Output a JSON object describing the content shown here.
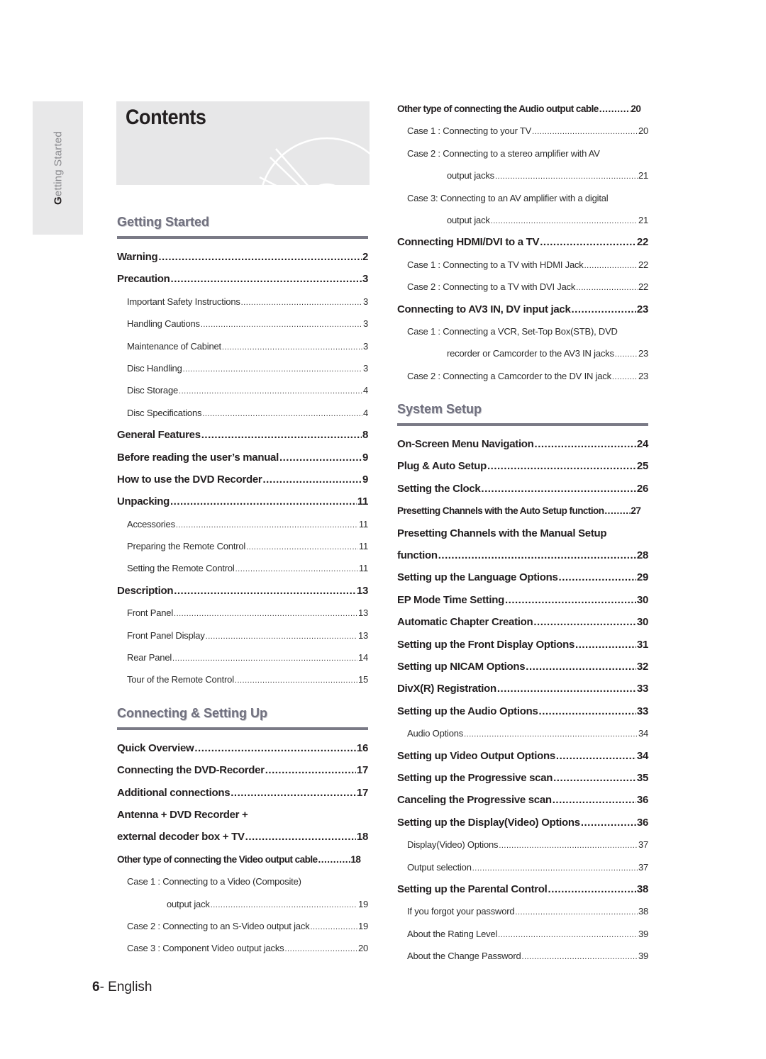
{
  "side_tab": {
    "first_letter": "G",
    "rest": "etting Started"
  },
  "title": "Contents",
  "left_column": {
    "sections": [
      {
        "heading": "Getting Started",
        "entries": [
          {
            "level": 1,
            "label": "Warning",
            "page": "2"
          },
          {
            "level": 1,
            "label": "Precaution",
            "page": "3"
          },
          {
            "level": 2,
            "label": "Important Safety Instructions",
            "page": "3"
          },
          {
            "level": 2,
            "label": "Handling Cautions",
            "page": "3"
          },
          {
            "level": 2,
            "label": "Maintenance of Cabinet",
            "page": "3"
          },
          {
            "level": 2,
            "label": "Disc Handling",
            "page": "3"
          },
          {
            "level": 2,
            "label": "Disc Storage",
            "page": "4"
          },
          {
            "level": 2,
            "label": "Disc Specifications",
            "page": "4"
          },
          {
            "level": 1,
            "label": "General Features",
            "page": "8"
          },
          {
            "level": 1,
            "label": "Before reading the user’s manual",
            "page": "9"
          },
          {
            "level": 1,
            "label": "How to use the DVD Recorder",
            "page": "9"
          },
          {
            "level": 1,
            "label": "Unpacking",
            "page": "11"
          },
          {
            "level": 2,
            "label": "Accessories",
            "page": "11"
          },
          {
            "level": 2,
            "label": "Preparing the Remote Control",
            "page": "11"
          },
          {
            "level": 2,
            "label": "Setting the Remote Control",
            "page": "11"
          },
          {
            "level": 1,
            "label": "Description",
            "page": "13"
          },
          {
            "level": 2,
            "label": "Front Panel",
            "page": "13"
          },
          {
            "level": 2,
            "label": "Front Panel Display",
            "page": "13"
          },
          {
            "level": 2,
            "label": "Rear Panel",
            "page": "14"
          },
          {
            "level": 2,
            "label": "Tour of the Remote Control",
            "page": "15"
          }
        ]
      },
      {
        "heading": "Connecting & Setting Up",
        "entries": [
          {
            "level": 1,
            "label": "Quick Overview",
            "page": "16"
          },
          {
            "level": 1,
            "label": "Connecting the DVD-Recorder",
            "page": "17"
          },
          {
            "level": 1,
            "label": "Additional connections",
            "page": "17"
          },
          {
            "level": 1,
            "label": "Antenna + DVD Recorder +",
            "page": ""
          },
          {
            "level": 1,
            "label": "external decoder box + TV ",
            "page": "18"
          },
          {
            "level": 1,
            "label": "Other type of connecting the Video output cable",
            "page": "18",
            "condensed": true
          },
          {
            "level": 2,
            "label": "Case 1 : Connecting to a Video (Composite)",
            "page": ""
          },
          {
            "level": 2,
            "label": "output jack ",
            "page": "19",
            "continuation": true
          },
          {
            "level": 2,
            "label": "Case 2 : Connecting to an S-Video output jack",
            "page": "19"
          },
          {
            "level": 2,
            "label": "Case 3 : Component Video output jacks",
            "page": "20"
          }
        ]
      }
    ]
  },
  "right_column": {
    "pre_entries": [
      {
        "level": 1,
        "label": "Other type of connecting the Audio output cable ",
        "page": "20",
        "condensed": true
      },
      {
        "level": 2,
        "label": "Case 1 : Connecting to your TV",
        "page": "20"
      },
      {
        "level": 2,
        "label": "Case 2 : Connecting to a stereo amplifier with AV",
        "page": ""
      },
      {
        "level": 2,
        "label": "output jacks  ",
        "page": "21",
        "continuation": true
      },
      {
        "level": 2,
        "label": "Case 3: Connecting to an AV amplifier with a digital",
        "page": ""
      },
      {
        "level": 2,
        "label": "output jack ",
        "page": "21",
        "continuation": true
      },
      {
        "level": 1,
        "label": "Connecting HDMI/DVI to a TV",
        "page": "22"
      },
      {
        "level": 2,
        "label": "Case 1 : Connecting to a TV with HDMI Jack ",
        "page": "22"
      },
      {
        "level": 2,
        "label": "Case 2 : Connecting to a TV with DVI Jack ",
        "page": "22"
      },
      {
        "level": 1,
        "label": "Connecting to AV3 IN, DV input jack",
        "page": "23"
      },
      {
        "level": 2,
        "label": "Case 1 : Connecting a VCR, Set-Top Box(STB), DVD",
        "page": ""
      },
      {
        "level": 2,
        "label": "recorder or Camcorder to the AV3 IN jacks ",
        "page": "23",
        "continuation": true
      },
      {
        "level": 2,
        "label": "Case 2 : Connecting a Camcorder to the DV IN jack ",
        "page": "23"
      }
    ],
    "sections": [
      {
        "heading": "System Setup",
        "entries": [
          {
            "level": 1,
            "label": "On-Screen Menu Navigation",
            "page": "24"
          },
          {
            "level": 1,
            "label": "Plug & Auto Setup ",
            "page": "25"
          },
          {
            "level": 1,
            "label": "Setting the Clock",
            "page": "26"
          },
          {
            "level": 1,
            "label": "Presetting Channels with the Auto Setup function",
            "page": "27",
            "condensed": true
          },
          {
            "level": 1,
            "label": "Presetting Channels with the Manual Setup",
            "page": ""
          },
          {
            "level": 1,
            "label": "function",
            "page": "28"
          },
          {
            "level": 1,
            "label": "Setting up the Language Options",
            "page": "29"
          },
          {
            "level": 1,
            "label": "EP Mode Time Setting",
            "page": "30"
          },
          {
            "level": 1,
            "label": "Automatic Chapter Creation ",
            "page": "30"
          },
          {
            "level": 1,
            "label": "Setting up the Front Display Options",
            "page": "31"
          },
          {
            "level": 1,
            "label": "Setting up NICAM Options ",
            "page": "32"
          },
          {
            "level": 1,
            "label": "DivX(R) Registration",
            "page": "33"
          },
          {
            "level": 1,
            "label": "Setting up the Audio Options ",
            "page": "33"
          },
          {
            "level": 2,
            "label": "Audio Options",
            "page": "34"
          },
          {
            "level": 1,
            "label": "Setting up Video Output Options",
            "page": "34"
          },
          {
            "level": 1,
            "label": "Setting up the Progressive scan",
            "page": "35"
          },
          {
            "level": 1,
            "label": "Canceling the Progressive scan ",
            "page": "36"
          },
          {
            "level": 1,
            "label": "Setting up the Display(Video) Options",
            "page": "36"
          },
          {
            "level": 2,
            "label": "Display(Video) Options ",
            "page": "37"
          },
          {
            "level": 2,
            "label": "Output selection ",
            "page": "37"
          },
          {
            "level": 1,
            "label": "Setting up the Parental Control",
            "page": "38"
          },
          {
            "level": 2,
            "label": "If you forgot your password",
            "page": "38"
          },
          {
            "level": 2,
            "label": "About the Rating Level ",
            "page": "39"
          },
          {
            "level": 2,
            "label": "About the Change Password ",
            "page": "39"
          }
        ]
      }
    ]
  },
  "footer": {
    "page_number": "6",
    "language": "- English"
  },
  "icons": {
    "header_graphic": "disc-icon"
  },
  "colors": {
    "section_heading": "#70707e",
    "section_rule": "#7a7a86",
    "panel_bg": "#e7e7e8"
  }
}
